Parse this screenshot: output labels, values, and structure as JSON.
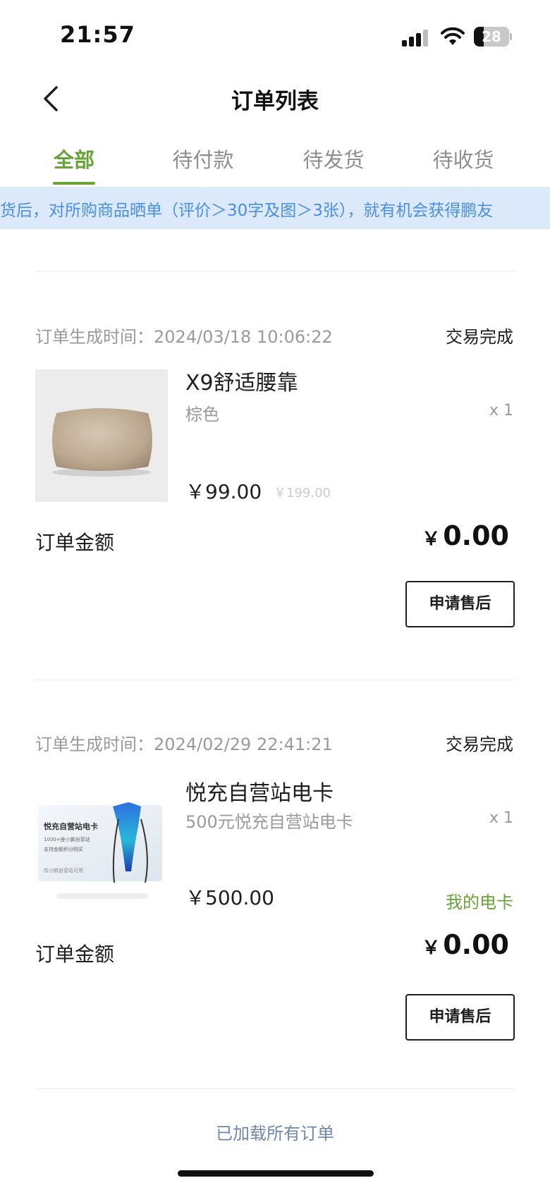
{
  "status_bar": {
    "time": "21:57",
    "battery_level": "28"
  },
  "nav": {
    "title": "订单列表",
    "back_icon": "chevron-left-icon"
  },
  "tabs": [
    {
      "label": "全部",
      "active": true
    },
    {
      "label": "待付款",
      "active": false
    },
    {
      "label": "待发货",
      "active": false
    },
    {
      "label": "待收货",
      "active": false
    }
  ],
  "notice": {
    "text": "货后，对所购商品晒单（评价＞30字及图＞3张），就有机会获得鹏友"
  },
  "orders": [
    {
      "time_label": "订单生成时间：2024/03/18 10:06:22",
      "status": "交易完成",
      "product_name": "X9舒适腰靠",
      "product_spec": "棕色",
      "quantity": "x 1",
      "price": "￥99.00",
      "original_price": "￥199.00",
      "amount_label": "订单金额",
      "amount_currency": "￥",
      "amount_value": "0.00",
      "action_label": "申请售后"
    },
    {
      "time_label": "订单生成时间：2024/02/29 22:41:21",
      "status": "交易完成",
      "product_name": "悦充自营站电卡",
      "product_spec": "500元悦充自营站电卡",
      "quantity": "x 1",
      "price": "￥500.00",
      "card_link": "我的电卡",
      "amount_label": "订单金额",
      "amount_currency": "￥",
      "amount_value": "0.00",
      "action_label": "申请售后",
      "thumb_text": {
        "title": "悦充自营站电卡",
        "line1": "1000+座小鹏自营站",
        "line2": "支持金额积分购买",
        "footer": "仅小鹏自营站可用"
      }
    }
  ],
  "footer": {
    "loaded_all": "已加载所有订单"
  },
  "colors": {
    "accent": "#6aa23a",
    "notice_bg": "#dbe9fb",
    "notice_text": "#4a8fe0",
    "muted_text": "#9a9a9a"
  }
}
